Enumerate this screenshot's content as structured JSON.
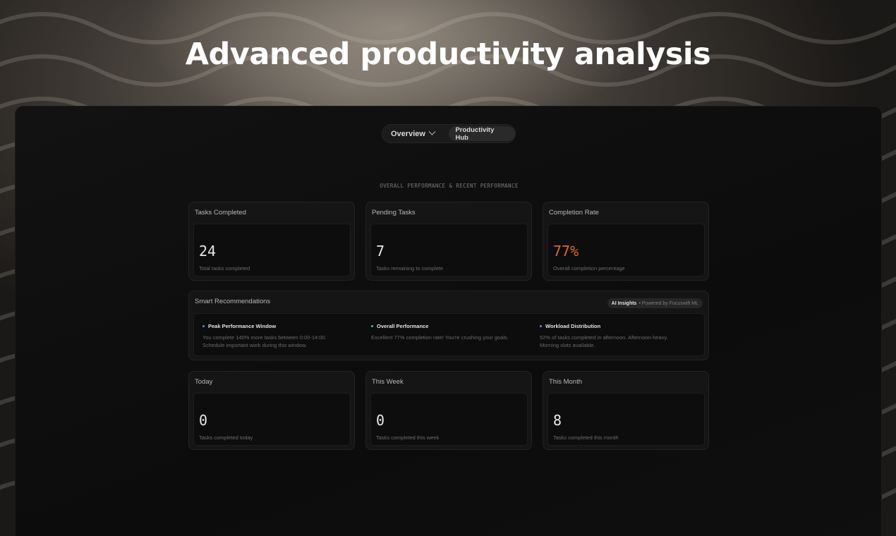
{
  "hero": {
    "title": "Advanced productivity analysis"
  },
  "nav": {
    "overview_label": "Overview",
    "hub_label": "Productivity Hub"
  },
  "section_label": "OVERALL PERFORMANCE & RECENT PERFORMANCE",
  "stats": [
    {
      "title": "Tasks Completed",
      "value": "24",
      "desc": "Total tasks completed"
    },
    {
      "title": "Pending Tasks",
      "value": "7",
      "desc": "Tasks remaining to complete"
    },
    {
      "title": "Completion Rate",
      "value": "77%",
      "desc": "Overall completion percentage"
    }
  ],
  "recommendations": {
    "title": "Smart Recommendations",
    "badge_main": "AI Insights",
    "badge_sub": "• Powered by Focuswift ML",
    "items": [
      {
        "title": "Peak Performance Window",
        "text": "You complete 140% more tasks between 0:00-14:00. Schedule important work during this window.",
        "dot_color": "#4a8cff"
      },
      {
        "title": "Overall Performance",
        "text": "Excellent 77% completion rate! You're crushing your goals.",
        "dot_color": "#3ecf6a"
      },
      {
        "title": "Workload Distribution",
        "text": "52% of tasks completed in afternoon. Afternoon-heavy. Morning slots available.",
        "dot_color": "#b35cff"
      }
    ]
  },
  "periods": [
    {
      "title": "Today",
      "value": "0",
      "desc": "Tasks completed today"
    },
    {
      "title": "This Week",
      "value": "0",
      "desc": "Tasks completed this week"
    },
    {
      "title": "This Month",
      "value": "8",
      "desc": "Tasks completed this month"
    }
  ],
  "colors": {
    "accent": "#e0652d",
    "background": "#0c0c0c"
  }
}
